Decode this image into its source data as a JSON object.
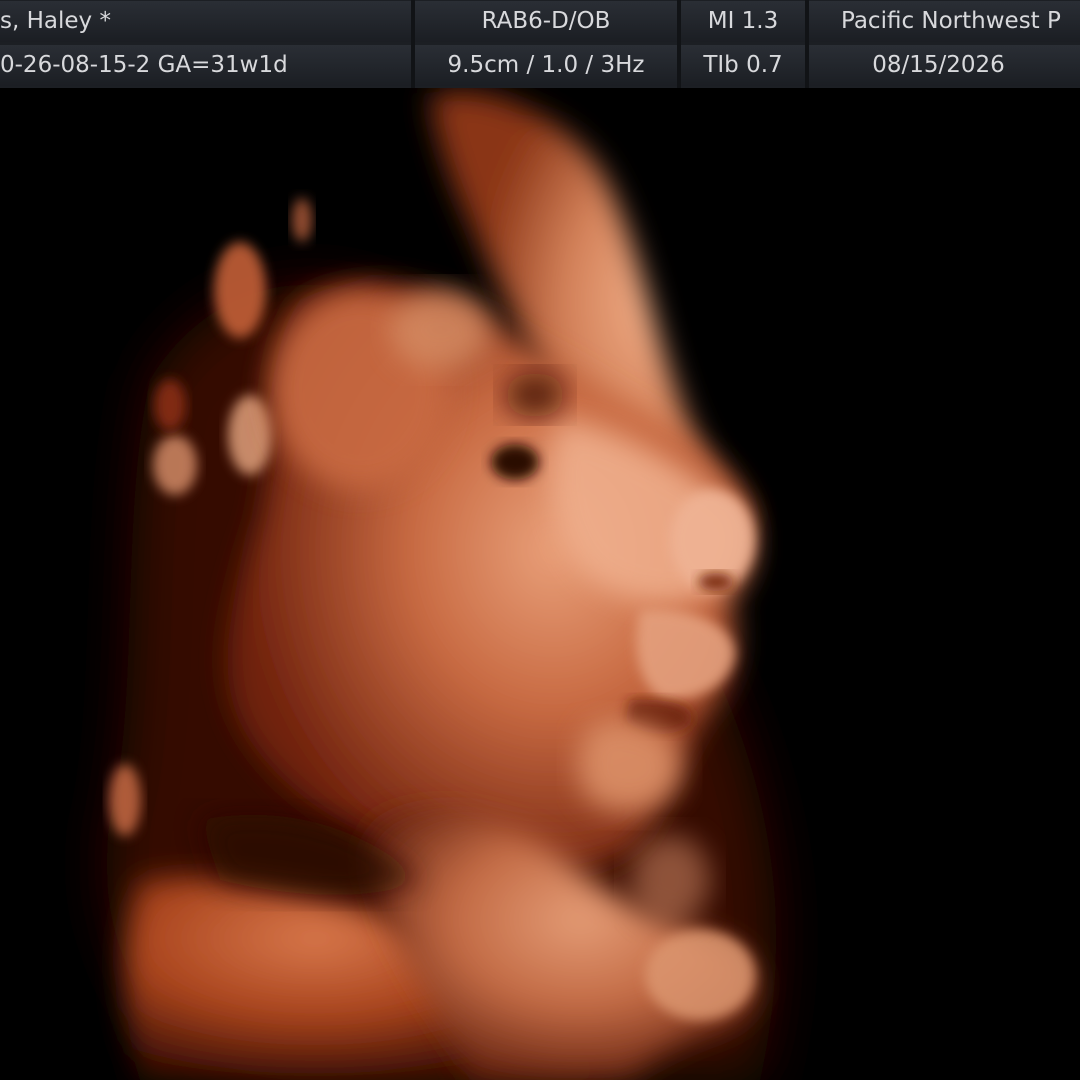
{
  "header": {
    "patient_name": "s, Haley  *",
    "patient_id_ga": "0-26-08-15-2  GA=31w1d",
    "probe_preset": "RAB6-D/OB",
    "depth_freq": "9.5cm / 1.0 /  3Hz",
    "mi": "MI  1.3",
    "tib": "TIb  0.7",
    "institution": "Pacific Northwest P",
    "date": "08/15/2026"
  },
  "viewport": {
    "mode": "3D surface render",
    "colors": {
      "background": "#000000",
      "tissue_highlight": "#f2b08c",
      "tissue_mid": "#c8643a",
      "tissue_shadow": "#5a1808"
    }
  }
}
